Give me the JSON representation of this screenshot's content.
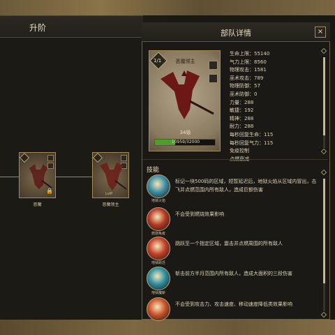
{
  "upgrade": {
    "title": "升阶",
    "units": [
      {
        "name": "恶魔",
        "locked": true
      },
      {
        "name": "恶魔领主",
        "locked": false,
        "tag": "LvlP"
      }
    ]
  },
  "detail": {
    "title": "部队详情",
    "close": "×",
    "portrait": {
      "name": "恶魔领主",
      "level_badge": "1/1",
      "level_label": "34级",
      "xp_text": "10959/32000",
      "xp_fraction": 0.342
    },
    "stats": [
      "生命上限：55140",
      "气力上限：8560",
      "物理攻击：1581",
      "巫术攻击：789",
      "物理防御：57",
      "巫术防御：0",
      "力量：288",
      "敏捷：192",
      "精神：288",
      "耐力：288",
      "每秒回复生命：115",
      "每秒回复气力：115",
      "免疫控制",
      "点燃衰减"
    ],
    "skills_title": "技能",
    "skills": [
      {
        "name": "地狱火焰",
        "icon": "hellfire-icon",
        "color": "#3e8fa4",
        "desc": "标记一块500码的区域，短暂延迟后，地狱火焰从区域内冒出，击飞并点燃范围内所有敌人，造成巨额伤害"
      },
      {
        "name": "燃烧免疫",
        "icon": "burn-immune-icon",
        "color": "#b33a25",
        "desc": "不会受到燃烧效果影响"
      },
      {
        "name": "地狱跃迁",
        "icon": "hell-leap-icon",
        "color": "#c2402a",
        "desc": "跳跃至一个指定区域，震击并点燃周围的所有敌人"
      },
      {
        "name": "地狱魔斩",
        "icon": "hell-slash-icon",
        "color": "#2f8ea0",
        "desc": "斩击前方半月范围内所有敌人，造成大面积的三段伤害"
      },
      {
        "name": "",
        "icon": "debuff-immune-icon",
        "color": "#c9532c",
        "desc": "不会受到攻击力、攻击速度、移动速度降低类效果影响"
      }
    ]
  }
}
